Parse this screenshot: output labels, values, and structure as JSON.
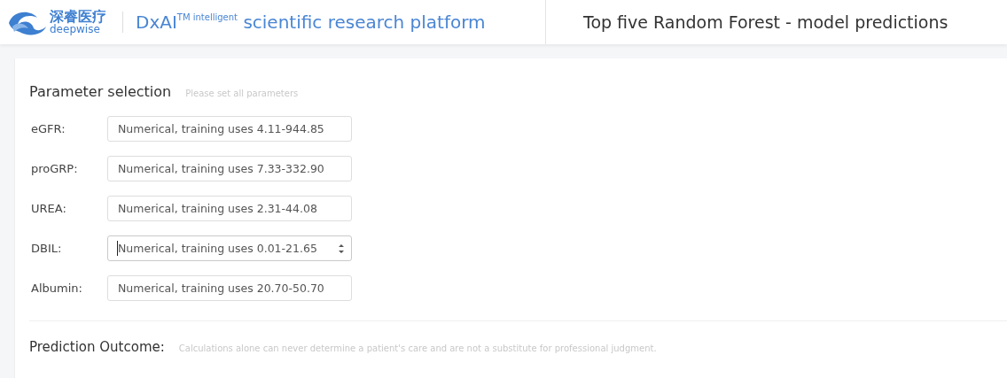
{
  "header": {
    "logo": {
      "brand_cn": "深睿医疗",
      "brand_en": "deepwise"
    },
    "platform_title": "DxAI$^{TM intelligent}$ scientific research platform",
    "page_title": "Top five Random Forest - model predictions"
  },
  "parameters": {
    "title": "Parameter selection",
    "hint": "Please set all parameters",
    "fields": [
      {
        "label": "eGFR:",
        "placeholder": "Numerical, training uses 4.11-944.85",
        "focused": false
      },
      {
        "label": "proGRP:",
        "placeholder": "Numerical, training uses 7.33-332.90",
        "focused": false
      },
      {
        "label": "UREA:",
        "placeholder": "Numerical, training uses 2.31-44.08",
        "focused": false
      },
      {
        "label": "DBIL:",
        "placeholder": "Numerical, training uses 0.01-21.65",
        "focused": true
      },
      {
        "label": "Albumin:",
        "placeholder": "Numerical, training uses 20.70-50.70",
        "focused": false
      }
    ]
  },
  "outcome": {
    "title": "Prediction Outcome:",
    "disclaimer": "Calculations alone can never determine a patient's care and are not a substitute for professional judgment."
  }
}
